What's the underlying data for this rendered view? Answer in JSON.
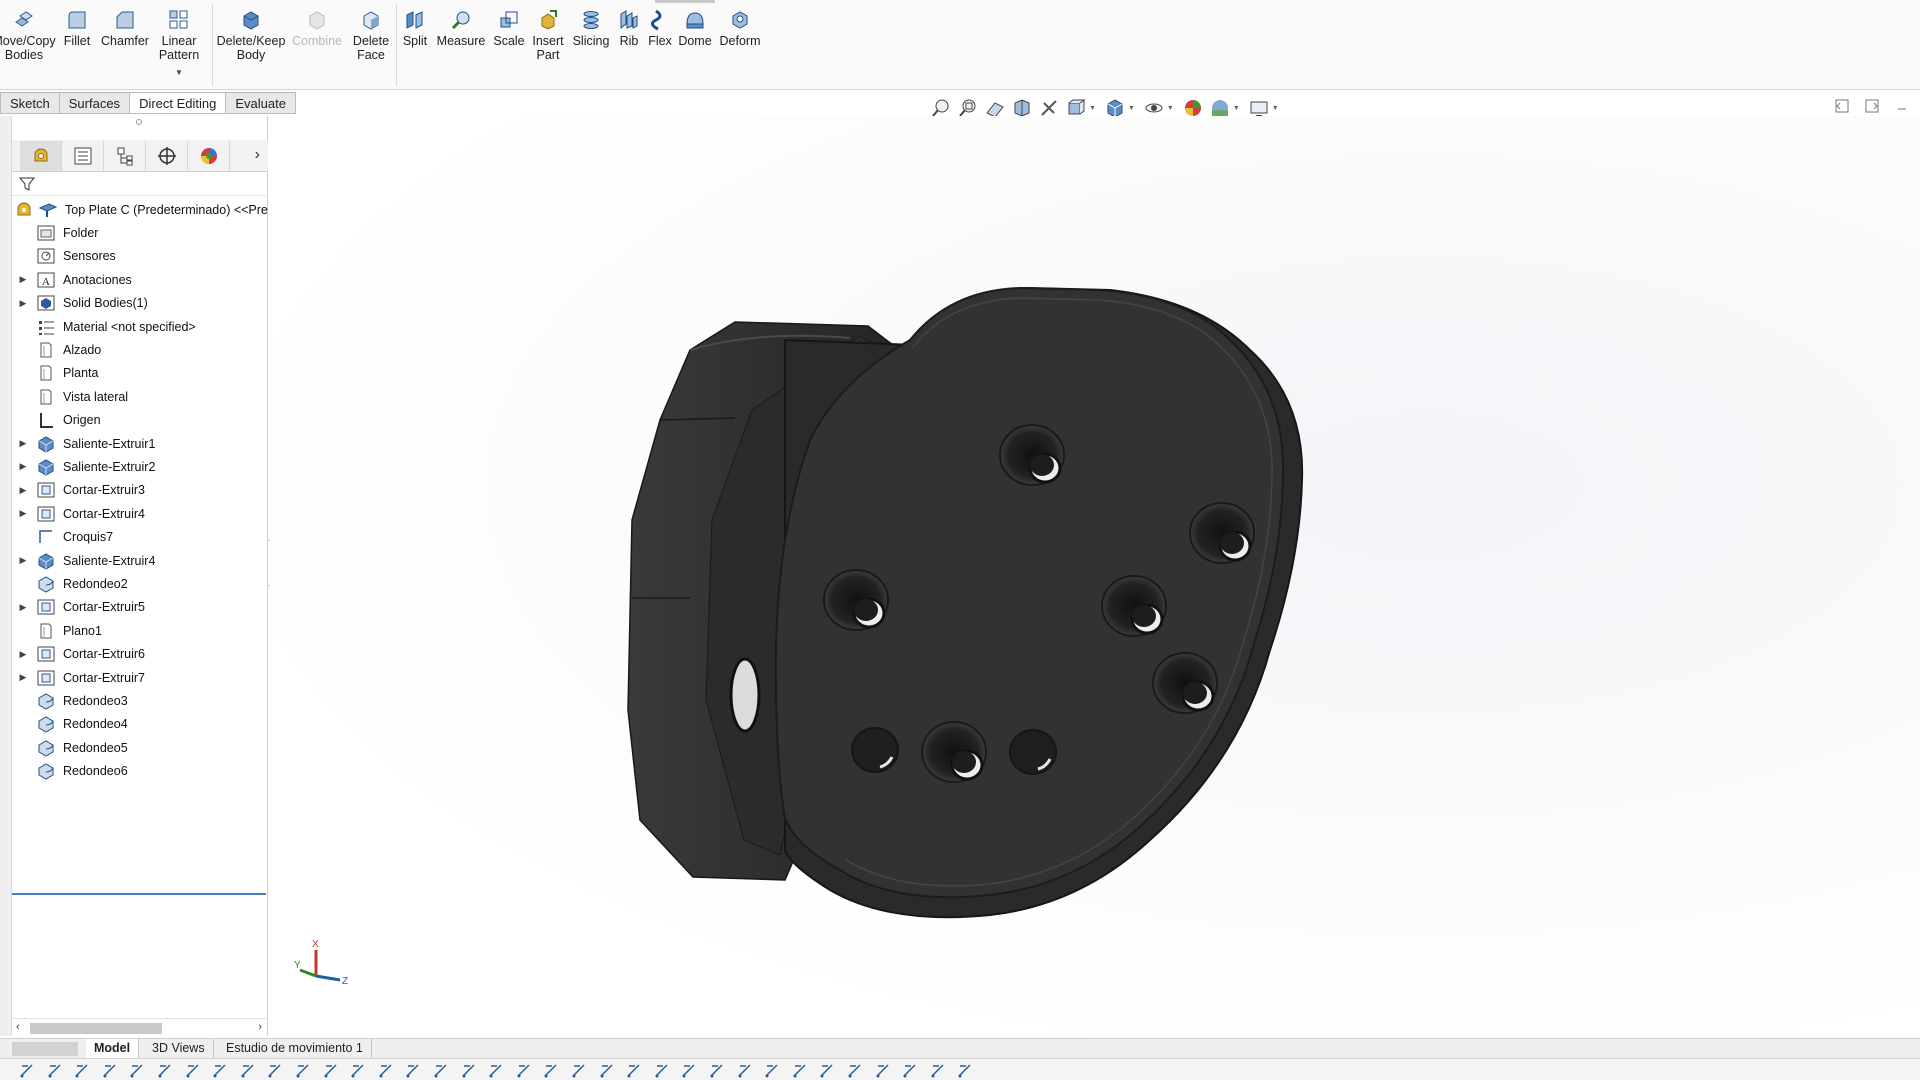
{
  "ribbon": {
    "buttons": [
      {
        "id": "move-copy-bodies",
        "label": "Move/Copy\nBodies",
        "icon": "move-copy-icon"
      },
      {
        "id": "fillet",
        "label": "Fillet",
        "icon": "fillet-icon"
      },
      {
        "id": "chamfer",
        "label": "Chamfer",
        "icon": "chamfer-icon"
      },
      {
        "id": "linear-pattern",
        "label": "Linear\nPattern",
        "icon": "linear-pattern-icon"
      },
      {
        "id": "delete-keep-body",
        "label": "Delete/Keep\nBody",
        "icon": "delete-body-icon"
      },
      {
        "id": "combine",
        "label": "Combine",
        "icon": "combine-icon",
        "disabled": true
      },
      {
        "id": "delete-face",
        "label": "Delete\nFace",
        "icon": "delete-face-icon"
      },
      {
        "id": "split",
        "label": "Split",
        "icon": "split-icon"
      },
      {
        "id": "measure",
        "label": "Measure",
        "icon": "measure-icon"
      },
      {
        "id": "scale",
        "label": "Scale",
        "icon": "scale-icon"
      },
      {
        "id": "insert-part",
        "label": "Insert\nPart",
        "icon": "insert-part-icon"
      },
      {
        "id": "slicing",
        "label": "Slicing",
        "icon": "slicing-icon"
      },
      {
        "id": "rib",
        "label": "Rib",
        "icon": "rib-icon"
      },
      {
        "id": "flex",
        "label": "Flex",
        "icon": "flex-icon"
      },
      {
        "id": "dome",
        "label": "Dome",
        "icon": "dome-icon"
      },
      {
        "id": "deform",
        "label": "Deform",
        "icon": "deform-icon"
      }
    ]
  },
  "command_tabs": [
    "Sketch",
    "Surfaces",
    "Direct Editing",
    "Evaluate"
  ],
  "active_command_tab": "Direct Editing",
  "feature_tree": {
    "root": "Top Plate C (Predeterminado) <<Pre",
    "items": [
      {
        "label": "Folder",
        "icon": "folder-icon",
        "expandable": false
      },
      {
        "label": "Sensores",
        "icon": "sensor-icon",
        "expandable": false
      },
      {
        "label": "Anotaciones",
        "icon": "annotation-icon",
        "expandable": true
      },
      {
        "label": "Solid Bodies(1)",
        "icon": "solid-bodies-icon",
        "expandable": true
      },
      {
        "label": "Material <not specified>",
        "icon": "material-icon",
        "expandable": false
      },
      {
        "label": "Alzado",
        "icon": "plane-icon",
        "expandable": false
      },
      {
        "label": "Planta",
        "icon": "plane-icon",
        "expandable": false
      },
      {
        "label": "Vista lateral",
        "icon": "plane-icon",
        "expandable": false
      },
      {
        "label": "Origen",
        "icon": "origin-icon",
        "expandable": false
      },
      {
        "label": "Saliente-Extruir1",
        "icon": "boss-extrude-icon",
        "expandable": true
      },
      {
        "label": "Saliente-Extruir2",
        "icon": "boss-extrude-icon",
        "expandable": true
      },
      {
        "label": "Cortar-Extruir3",
        "icon": "cut-extrude-icon",
        "expandable": true
      },
      {
        "label": "Cortar-Extruir4",
        "icon": "cut-extrude-icon",
        "expandable": true
      },
      {
        "label": "Croquis7",
        "icon": "sketch-icon",
        "expandable": false
      },
      {
        "label": "Saliente-Extruir4",
        "icon": "boss-extrude-icon",
        "expandable": true
      },
      {
        "label": "Redondeo2",
        "icon": "fillet-feature-icon",
        "expandable": false
      },
      {
        "label": "Cortar-Extruir5",
        "icon": "cut-extrude-icon",
        "expandable": true
      },
      {
        "label": "Plano1",
        "icon": "plane-icon",
        "expandable": false
      },
      {
        "label": "Cortar-Extruir6",
        "icon": "cut-extrude-icon",
        "expandable": true
      },
      {
        "label": "Cortar-Extruir7",
        "icon": "cut-extrude-icon",
        "expandable": true
      },
      {
        "label": "Redondeo3",
        "icon": "fillet-feature-icon",
        "expandable": false
      },
      {
        "label": "Redondeo4",
        "icon": "fillet-feature-icon",
        "expandable": false
      },
      {
        "label": "Redondeo5",
        "icon": "fillet-feature-icon",
        "expandable": false
      },
      {
        "label": "Redondeo6",
        "icon": "fillet-feature-icon",
        "expandable": false
      }
    ]
  },
  "bottom_tabs": [
    "Model",
    "3D Views",
    "Estudio de movimiento 1"
  ],
  "active_bottom_tab": "Model",
  "triad": {
    "x_label": "X",
    "y_label": "Y",
    "z_label": "Z"
  },
  "colors": {
    "model": "#2e2e2e",
    "accent_blue": "#1f5fa8",
    "selection_line": "#4a7fbd"
  }
}
